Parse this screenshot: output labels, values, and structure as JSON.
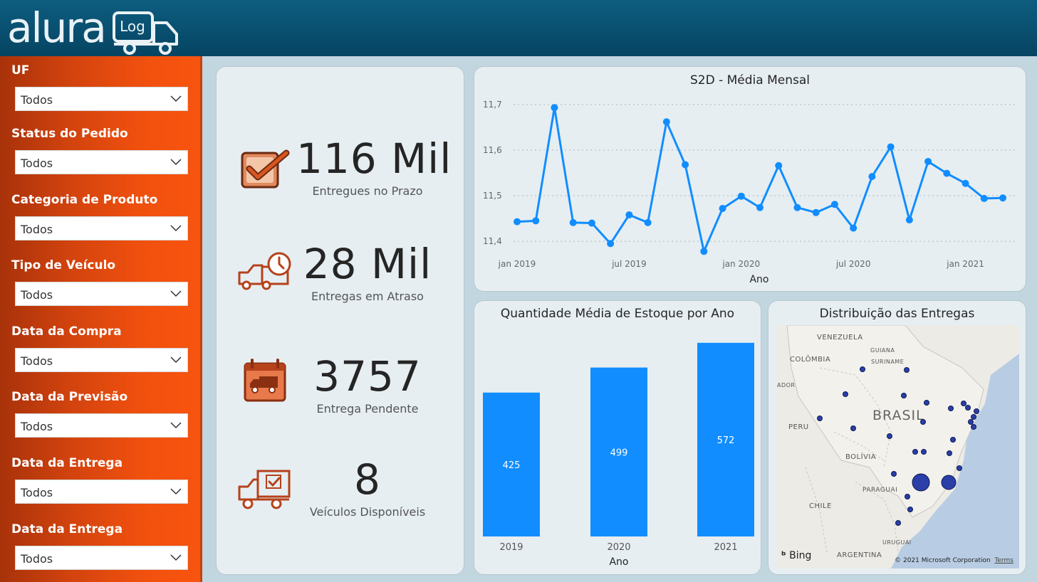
{
  "header": {
    "logo_text": "alura",
    "logo_badge": "Log"
  },
  "filters": [
    {
      "label": "UF",
      "value": "Todos"
    },
    {
      "label": "Status do Pedido",
      "value": "Todos"
    },
    {
      "label": "Categoria de Produto",
      "value": "Todos"
    },
    {
      "label": "Tipo de Veículo",
      "value": "Todos"
    },
    {
      "label": "Data da Compra",
      "value": "Todos"
    },
    {
      "label": "Data da Previsão",
      "value": "Todos"
    },
    {
      "label": "Data da Entrega",
      "value": "Todos"
    },
    {
      "label": "Data da Entrega",
      "value": "Todos"
    }
  ],
  "kpis": [
    {
      "value": "116 Mil",
      "label": "Entregues no Prazo",
      "icon": "checkbox-icon"
    },
    {
      "value": "28 Mil",
      "label": "Entregas em Atraso",
      "icon": "late-truck-icon"
    },
    {
      "value": "3757",
      "label": "Entrega Pendente",
      "icon": "calendar-truck-icon"
    },
    {
      "value": "8",
      "label": "Veículos Disponíveis",
      "icon": "truck-check-icon"
    }
  ],
  "colors": {
    "accent": "#118dff",
    "sidebar": "#f0500e",
    "header": "#0a5275",
    "icon": "#b5421b"
  },
  "chart_data": [
    {
      "type": "line",
      "title": "S2D - Média Mensal",
      "xlabel": "Ano",
      "ylabel": "",
      "x_ticks": [
        "jan 2019",
        "jul 2019",
        "jan 2020",
        "jul 2020",
        "jan 2021"
      ],
      "y_ticks": [
        "11,4",
        "11,5",
        "11,6",
        "11,7"
      ],
      "ylim": [
        11.38,
        11.72
      ],
      "x": [
        "2019-01",
        "2019-02",
        "2019-03",
        "2019-04",
        "2019-05",
        "2019-06",
        "2019-07",
        "2019-08",
        "2019-09",
        "2019-10",
        "2019-11",
        "2019-12",
        "2020-01",
        "2020-02",
        "2020-03",
        "2020-04",
        "2020-05",
        "2020-06",
        "2020-07",
        "2020-08",
        "2020-09",
        "2020-10",
        "2020-11",
        "2020-12",
        "2021-01",
        "2021-02",
        "2021-03"
      ],
      "values": [
        11.443,
        11.445,
        11.693,
        11.441,
        11.44,
        11.395,
        11.458,
        11.441,
        11.662,
        11.568,
        11.378,
        11.472,
        11.499,
        11.474,
        11.566,
        11.474,
        11.463,
        11.481,
        11.429,
        11.542,
        11.607,
        11.447,
        11.575,
        11.549,
        11.527,
        11.494,
        11.495
      ],
      "grid": true
    },
    {
      "type": "bar",
      "title": "Quantidade Média de Estoque por Ano",
      "xlabel": "Ano",
      "ylabel": "",
      "categories": [
        "2019",
        "2020",
        "2021"
      ],
      "values": [
        425,
        499,
        572
      ],
      "ylim": [
        0,
        620
      ]
    }
  ],
  "map": {
    "title": "Distribuição das Entregas",
    "country_labels": [
      "VENEZUELA",
      "GUIANA",
      "SURINAME",
      "COLÔMBIA",
      "ADOR",
      "PERU",
      "BOLÍVIA",
      "PARAGUAI",
      "CHILE",
      "URUGUAI",
      "ARGENTINA"
    ],
    "main_label": "BRASIL",
    "attribution": "Bing",
    "copyright": "© 2021 Microsoft Corporation",
    "terms": "Terms"
  }
}
